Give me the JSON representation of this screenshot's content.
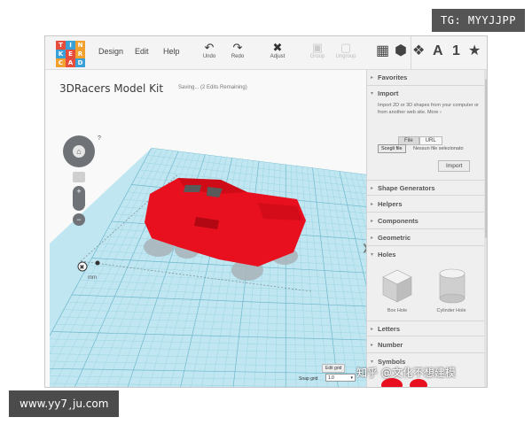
{
  "watermarks": {
    "top": "TG: MYYJJPP",
    "bottom": "www.yy7¸ju.com",
    "zhihu": "知乎 @文化不想建模"
  },
  "logo": {
    "letters": [
      "T",
      "I",
      "N",
      "K",
      "E",
      "R",
      "C",
      "A",
      "D"
    ],
    "colors": [
      "#e64c3c",
      "#3aa0d8",
      "#f2a12e",
      "#3aa0d8",
      "#e64c3c",
      "#f2a12e",
      "#f2a12e",
      "#e64c3c",
      "#3aa0d8"
    ]
  },
  "menu": {
    "design": "Design",
    "edit": "Edit",
    "help": "Help"
  },
  "toolbar": {
    "undo": "Undo",
    "redo": "Redo",
    "adjust": "Adjust",
    "group": "Group",
    "ungroup": "Ungroup",
    "view_letter": "A",
    "view_number": "1",
    "star": "★"
  },
  "project": {
    "title": "3DRacers Model Kit",
    "saving_status": "Saving... (2 Edits Remaining)"
  },
  "workplane": {
    "help_mark": "?",
    "unit": "mm",
    "edit_grid_label": "Edit grid",
    "snap_grid_label": "Snap grid",
    "snap_grid_value": "1.0"
  },
  "panel": {
    "favorites": "Favorites",
    "import_title": "Import",
    "import_text": "Import 2D or 3D shapes from your computer or from another web site. More ›",
    "tab_file": "File",
    "tab_url": "URL",
    "choose_file": "Scegli file",
    "no_file": "Nessun file selezionato",
    "import_button": "Import",
    "shape_generators": "Shape Generators",
    "helpers": "Helpers",
    "components": "Components",
    "geometric": "Geometric",
    "holes": "Holes",
    "box_hole": "Box Hole",
    "cylinder_hole": "Cylinder Hole",
    "letters": "Letters",
    "number": "Number",
    "symbols": "Symbols"
  },
  "colors": {
    "car_red": "#e8101e",
    "grid_blue": "#a9dcea"
  }
}
